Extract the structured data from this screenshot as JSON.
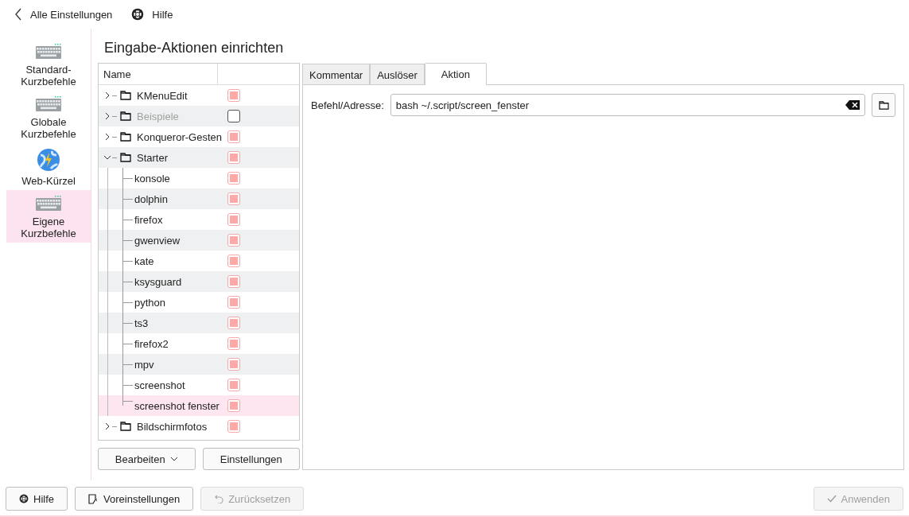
{
  "header": {
    "back_label": "Alle Einstellungen",
    "help_label": "Hilfe"
  },
  "sidebar": {
    "items": [
      {
        "label": "Standard-Kurzbefehle",
        "kind": "keyboard",
        "selected": false
      },
      {
        "label": "Globale Kurzbefehle",
        "kind": "keyboard",
        "selected": false
      },
      {
        "label": "Web-Kürzel",
        "kind": "globe",
        "selected": false
      },
      {
        "label": "Eigene Kurzbefehle",
        "kind": "keyboard",
        "selected": true
      }
    ]
  },
  "page_title": "Eingabe-Aktionen einrichten",
  "tree": {
    "columns": [
      "Name"
    ],
    "items": [
      {
        "label": "KMenuEdit",
        "expanded": false,
        "checked": true,
        "disabled": false,
        "selected": false
      },
      {
        "label": "Beispiele",
        "expanded": false,
        "checked": false,
        "disabled": true,
        "selected": false
      },
      {
        "label": "Konqueror-Gesten",
        "expanded": false,
        "checked": true,
        "disabled": false,
        "selected": false
      },
      {
        "label": "Starter",
        "expanded": true,
        "checked": true,
        "disabled": false,
        "selected": false,
        "children": [
          {
            "label": "konsole",
            "checked": true,
            "disabled": false,
            "selected": false
          },
          {
            "label": "dolphin",
            "checked": true,
            "disabled": false,
            "selected": false
          },
          {
            "label": "firefox",
            "checked": true,
            "disabled": false,
            "selected": false
          },
          {
            "label": "gwenview",
            "checked": true,
            "disabled": false,
            "selected": false
          },
          {
            "label": "kate",
            "checked": true,
            "disabled": false,
            "selected": false
          },
          {
            "label": "ksysguard",
            "checked": true,
            "disabled": false,
            "selected": false
          },
          {
            "label": "python",
            "checked": true,
            "disabled": false,
            "selected": false
          },
          {
            "label": "ts3",
            "checked": true,
            "disabled": false,
            "selected": false
          },
          {
            "label": "firefox2",
            "checked": true,
            "disabled": false,
            "selected": false
          },
          {
            "label": "mpv",
            "checked": true,
            "disabled": false,
            "selected": false
          },
          {
            "label": "screenshot",
            "checked": true,
            "disabled": false,
            "selected": false
          },
          {
            "label": "screenshot fenster",
            "checked": true,
            "disabled": false,
            "selected": true
          }
        ]
      },
      {
        "label": "Bildschirmfotos",
        "expanded": false,
        "checked": true,
        "disabled": false,
        "selected": false
      }
    ]
  },
  "tree_buttons": {
    "edit": "Bearbeiten",
    "settings": "Einstellungen"
  },
  "tabs": [
    {
      "label": "Kommentar",
      "selected": false
    },
    {
      "label": "Auslöser",
      "selected": false
    },
    {
      "label": "Aktion",
      "selected": true
    }
  ],
  "action": {
    "label": "Befehl/Adresse:",
    "value": "bash ~/.script/screen_fenster"
  },
  "footer": {
    "help": "Hilfe",
    "defaults": "Voreinstellungen",
    "reset": {
      "label": "Zurücksetzen",
      "disabled": true
    },
    "apply": {
      "label": "Anwenden",
      "disabled": true
    }
  }
}
